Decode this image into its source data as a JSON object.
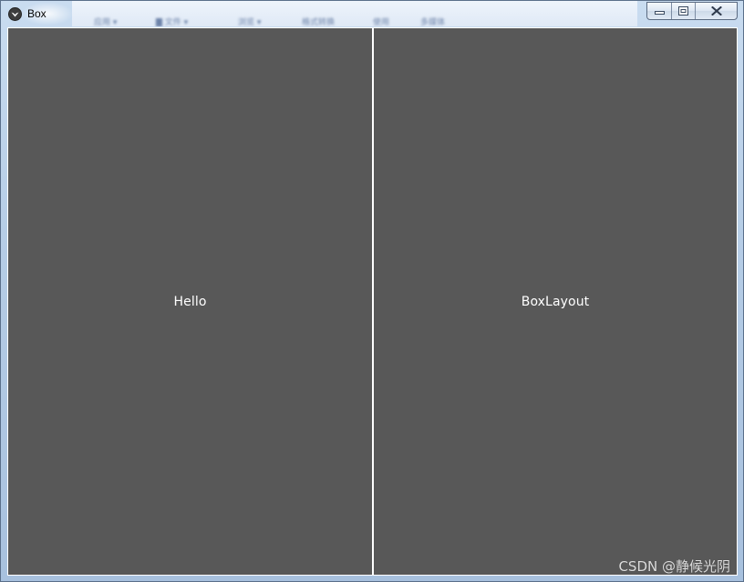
{
  "window": {
    "title": "Box",
    "icon": "kivy-icon",
    "caption_buttons": [
      "minimize-icon",
      "maximize-icon",
      "close-icon"
    ]
  },
  "background_blur_text": [
    "应用 ▾",
    "▇ 文件 ▾",
    "浏览 ▾",
    "格式转换",
    "使用",
    "多媒体"
  ],
  "panels": [
    {
      "label": "Hello"
    },
    {
      "label": "BoxLayout"
    }
  ],
  "watermark": "CSDN @静候光阴",
  "colors": {
    "panel_background": "#585858",
    "panel_text": "#ffffff",
    "divider": "#ffffff"
  }
}
